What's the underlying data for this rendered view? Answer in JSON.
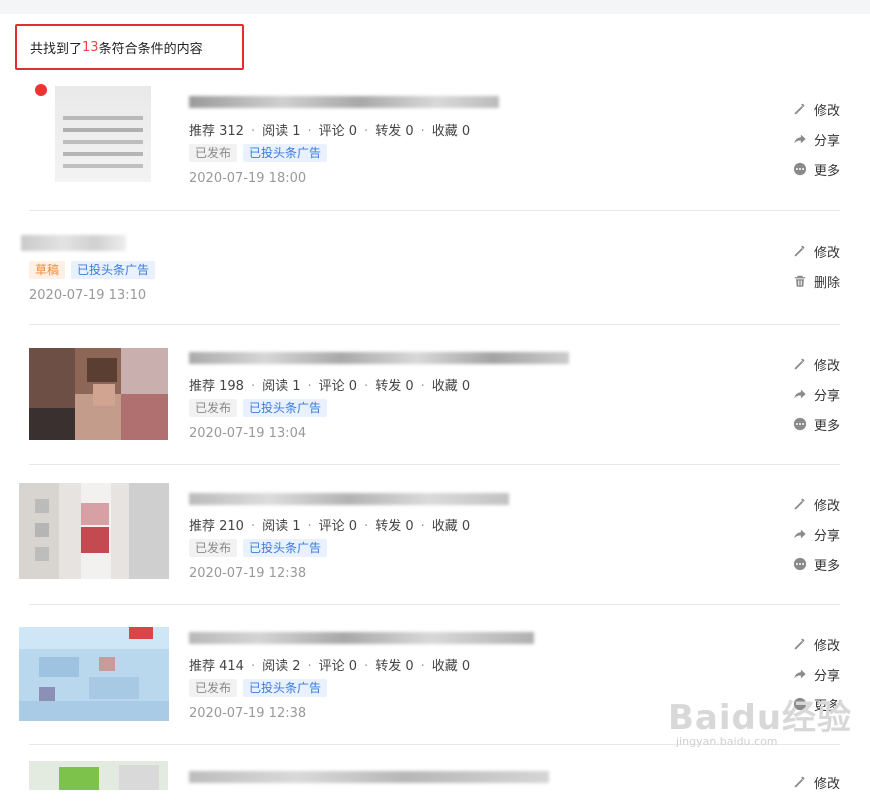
{
  "search": {
    "prefix": "共找到了",
    "count": "13",
    "suffix": "条符合条件的内容"
  },
  "items": [
    {
      "stats": {
        "recommend": "推荐 312",
        "read": "阅读 1",
        "comment": "评论 0",
        "share": "转发 0",
        "fav": "收藏 0"
      },
      "tags": [
        "已发布",
        "已投头条广告"
      ],
      "time": "2020-07-19 18:00",
      "actions": [
        "修改",
        "分享",
        "更多"
      ]
    },
    {
      "tags": [
        "草稿",
        "已投头条广告"
      ],
      "time": "2020-07-19 13:10",
      "actions": [
        "修改",
        "删除"
      ]
    },
    {
      "stats": {
        "recommend": "推荐 198",
        "read": "阅读 1",
        "comment": "评论 0",
        "share": "转发 0",
        "fav": "收藏 0"
      },
      "tags": [
        "已发布",
        "已投头条广告"
      ],
      "time": "2020-07-19 13:04",
      "actions": [
        "修改",
        "分享",
        "更多"
      ]
    },
    {
      "stats": {
        "recommend": "推荐 210",
        "read": "阅读 1",
        "comment": "评论 0",
        "share": "转发 0",
        "fav": "收藏 0"
      },
      "tags": [
        "已发布",
        "已投头条广告"
      ],
      "time": "2020-07-19 12:38",
      "actions": [
        "修改",
        "分享",
        "更多"
      ]
    },
    {
      "stats": {
        "recommend": "推荐 414",
        "read": "阅读 2",
        "comment": "评论 0",
        "share": "转发 0",
        "fav": "收藏 0"
      },
      "tags": [
        "已发布",
        "已投头条广告"
      ],
      "time": "2020-07-19 12:38",
      "actions": [
        "修改",
        "分享",
        "更多"
      ]
    },
    {
      "actions": [
        "修改"
      ]
    }
  ],
  "watermark": {
    "brand": "Baidu经验",
    "sub": "jingyan.baidu.com"
  },
  "colors": {
    "highlight_border": "#e02f2f",
    "count": "#f04142",
    "ad_tag": "#3a7be0",
    "draft_tag": "#f08a3c"
  },
  "icons": {
    "edit": "pencil-icon",
    "share": "share-arrow-icon",
    "more": "more-dots-icon",
    "delete": "trash-icon"
  }
}
